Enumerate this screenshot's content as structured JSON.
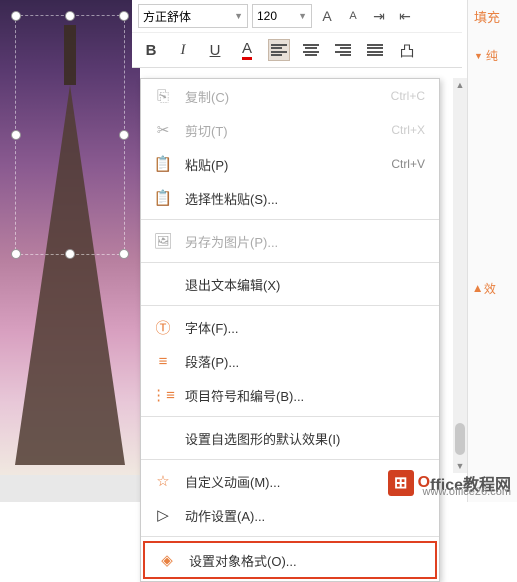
{
  "toolbar": {
    "font_name": "方正舒体",
    "font_size": "120",
    "bold": "B",
    "italic": "I",
    "underline": "U"
  },
  "menu": {
    "copy": {
      "label": "复制(C)",
      "shortcut": "Ctrl+C"
    },
    "cut": {
      "label": "剪切(T)",
      "shortcut": "Ctrl+X"
    },
    "paste": {
      "label": "粘贴(P)",
      "shortcut": "Ctrl+V"
    },
    "paste_special": {
      "label": "选择性粘贴(S)..."
    },
    "save_as_pic": {
      "label": "另存为图片(P)..."
    },
    "exit_text_edit": {
      "label": "退出文本编辑(X)"
    },
    "font": {
      "label": "字体(F)..."
    },
    "paragraph": {
      "label": "段落(P)..."
    },
    "bullets": {
      "label": "项目符号和编号(B)..."
    },
    "default_shape": {
      "label": "设置自选图形的默认效果(I)"
    },
    "custom_anim": {
      "label": "自定义动画(M)..."
    },
    "action": {
      "label": "动作设置(A)..."
    },
    "format_object": {
      "label": "设置对象格式(O)..."
    }
  },
  "sidepanel": {
    "tab": "填充",
    "item1": "纯",
    "item2": "效"
  },
  "watermark": {
    "brand_o": "O",
    "brand_rest": "ffice教程网",
    "url": "www.office26.com"
  }
}
